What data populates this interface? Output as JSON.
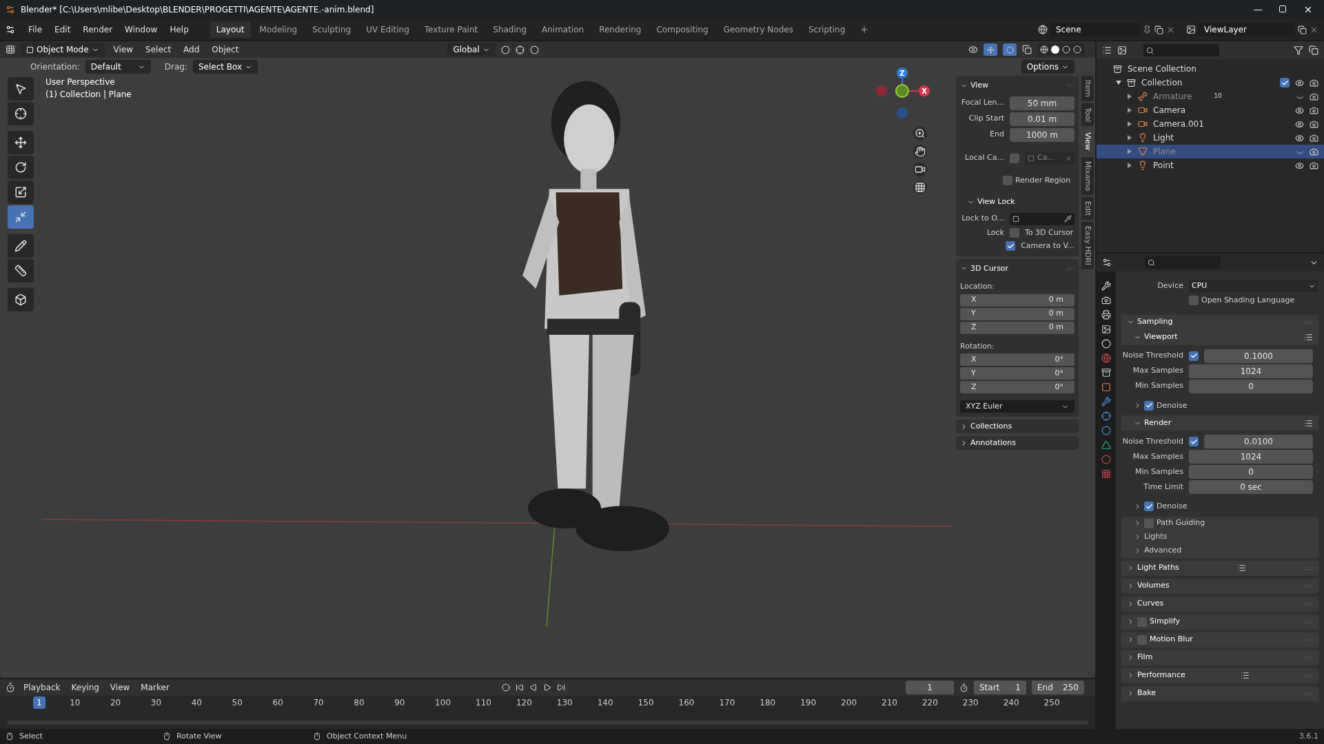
{
  "title_bar": {
    "title": "Blender* [C:\\Users\\mlibe\\Desktop\\BLENDER\\PROGETTI\\AGENTE\\AGENTE.-anim.blend]"
  },
  "menu": [
    "File",
    "Edit",
    "Render",
    "Window",
    "Help"
  ],
  "workspaces": [
    {
      "label": "Layout",
      "selected": true
    },
    {
      "label": "Modeling",
      "selected": false
    },
    {
      "label": "Sculpting",
      "selected": false
    },
    {
      "label": "UV Editing",
      "selected": false
    },
    {
      "label": "Texture Paint",
      "selected": false
    },
    {
      "label": "Shading",
      "selected": false
    },
    {
      "label": "Animation",
      "selected": false
    },
    {
      "label": "Rendering",
      "selected": false
    },
    {
      "label": "Compositing",
      "selected": false
    },
    {
      "label": "Geometry Nodes",
      "selected": false
    },
    {
      "label": "Scripting",
      "selected": false
    }
  ],
  "scene": "Scene",
  "view_layer": "ViewLayer",
  "header": {
    "mode": "Object Mode",
    "menus": [
      "View",
      "Select",
      "Add",
      "Object"
    ],
    "transform": "Global",
    "orientation_label": "Orientation:",
    "orientation": "Default",
    "drag_label": "Drag:",
    "drag": "Select Box",
    "options": "Options"
  },
  "tools": [
    {
      "kind": "select",
      "selected": false
    },
    {
      "kind": "cursor",
      "selected": false
    },
    {
      "kind": "move",
      "selected": false
    },
    {
      "kind": "rotate",
      "selected": false
    },
    {
      "kind": "scale",
      "selected": false
    },
    {
      "kind": "transform",
      "selected": true
    },
    {
      "kind": "annotate",
      "selected": false
    },
    {
      "kind": "measure",
      "selected": false
    },
    {
      "kind": "add-cube",
      "selected": false
    }
  ],
  "viewport_info": [
    "User Perspective",
    "(1) Collection | Plane"
  ],
  "gizmo": {
    "z": "Z",
    "x": "X"
  },
  "sidebar_tabs": [
    {
      "label": "Item",
      "selected": false
    },
    {
      "label": "Tool",
      "selected": false
    },
    {
      "label": "View",
      "selected": true
    },
    {
      "label": "Mixamo",
      "selected": false
    },
    {
      "label": "Edit",
      "selected": false
    },
    {
      "label": "Easy HDRI",
      "selected": false
    }
  ],
  "n_panel": {
    "view": {
      "title": "View",
      "fields": [
        {
          "label": "Focal Len...",
          "value": "50 mm"
        },
        {
          "label": "Clip Start",
          "value": "0.01 m"
        },
        {
          "label": "End",
          "value": "1000 m"
        }
      ],
      "local_camera": {
        "label": "Local Ca...",
        "checked": false,
        "value": "Ca..."
      },
      "render_region": {
        "label": "Render Region",
        "checked": false
      }
    },
    "view_lock": {
      "title": "View Lock",
      "lock_to_label": "Lock to O...",
      "lock_label": "Lock",
      "options": [
        {
          "label": "To 3D Cursor",
          "checked": false
        },
        {
          "label": "Camera to V...",
          "checked": true
        }
      ]
    },
    "cursor": {
      "title": "3D Cursor",
      "location_label": "Location:",
      "location": [
        {
          "axis": "X",
          "value": "0 m"
        },
        {
          "axis": "Y",
          "value": "0 m"
        },
        {
          "axis": "Z",
          "value": "0 m"
        }
      ],
      "rotation_label": "Rotation:",
      "rotation": [
        {
          "axis": "X",
          "value": "0°"
        },
        {
          "axis": "Y",
          "value": "0°"
        },
        {
          "axis": "Z",
          "value": "0°"
        }
      ],
      "mode": "XYZ Euler"
    },
    "collapsed": [
      "Collections",
      "Annotations"
    ]
  },
  "outliner": {
    "root": "Scene Collection",
    "collection": {
      "label": "Collection",
      "checked": true,
      "expanded": true,
      "children": [
        {
          "label": "Armature",
          "kind": "armature",
          "selected": false,
          "visible": false,
          "badge": "10"
        },
        {
          "label": "Camera",
          "kind": "camera",
          "selected": false,
          "visible": true
        },
        {
          "label": "Camera.001",
          "kind": "camera",
          "selected": false,
          "visible": true
        },
        {
          "label": "Light",
          "kind": "light",
          "selected": false,
          "visible": true
        },
        {
          "label": "Plane",
          "kind": "mesh",
          "selected": true,
          "visible": false
        },
        {
          "label": "Point",
          "kind": "light",
          "selected": false,
          "visible": true
        }
      ]
    }
  },
  "properties": {
    "device_label": "Device",
    "device": "CPU",
    "osl": {
      "label": "Open Shading Language",
      "checked": false
    },
    "sampling": {
      "title": "Sampling",
      "groups": [
        {
          "title": "Viewport",
          "rows": [
            {
              "kind": "check-number",
              "label": "Noise Threshold",
              "checked": true,
              "value": "0.1000"
            },
            {
              "kind": "number",
              "label": "Max Samples",
              "value": "1024"
            },
            {
              "kind": "number",
              "label": "Min Samples",
              "value": "0"
            }
          ],
          "denoise": {
            "label": "Denoise",
            "checked": true
          }
        },
        {
          "title": "Render",
          "rows": [
            {
              "kind": "check-number",
              "label": "Noise Threshold",
              "checked": true,
              "value": "0.0100"
            },
            {
              "kind": "number",
              "label": "Max Samples",
              "value": "1024"
            },
            {
              "kind": "number",
              "label": "Min Samples",
              "value": "0"
            },
            {
              "kind": "number",
              "label": "Time Limit",
              "value": "0 sec"
            }
          ],
          "denoise": {
            "label": "Denoise",
            "checked": true
          }
        }
      ],
      "extras": [
        {
          "kind": "check",
          "label": "Path Guiding",
          "checked": false
        },
        {
          "kind": "plain",
          "label": "Lights"
        },
        {
          "kind": "plain",
          "label": "Advanced"
        }
      ]
    },
    "panels": [
      {
        "kind": "plain",
        "title": "Light Paths",
        "presets": true
      },
      {
        "kind": "plain",
        "title": "Volumes",
        "presets": false
      },
      {
        "kind": "plain",
        "title": "Curves",
        "presets": false
      },
      {
        "kind": "check",
        "title": "Simplify",
        "checked": false,
        "presets": false
      },
      {
        "kind": "check",
        "title": "Motion Blur",
        "checked": false,
        "presets": false
      },
      {
        "kind": "plain",
        "title": "Film",
        "presets": false
      },
      {
        "kind": "plain",
        "title": "Performance",
        "presets": true
      },
      {
        "kind": "plain",
        "title": "Bake",
        "presets": false
      }
    ]
  },
  "timeline": {
    "menus": [
      "Playback",
      "Keying",
      "View",
      "Marker"
    ],
    "current": "1",
    "start_label": "Start",
    "start": "1",
    "end_label": "End",
    "end": "250",
    "ticks": [
      "1",
      "10",
      "20",
      "30",
      "40",
      "50",
      "60",
      "70",
      "80",
      "90",
      "100",
      "110",
      "120",
      "130",
      "140",
      "150",
      "160",
      "170",
      "180",
      "190",
      "200",
      "210",
      "220",
      "230",
      "240",
      "250"
    ]
  },
  "status": [
    "Select",
    "Rotate View",
    "Object Context Menu"
  ],
  "version": "3.6.1"
}
